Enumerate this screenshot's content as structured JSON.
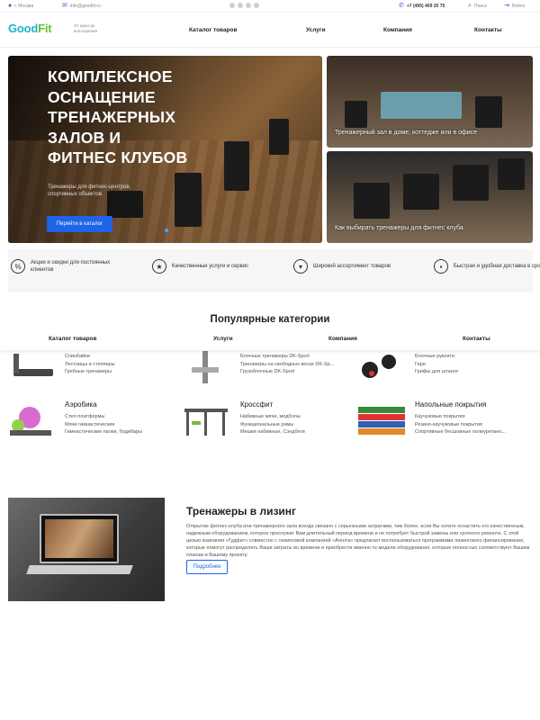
{
  "topbar": {
    "city": "г. Москва",
    "email": "info@goodfit.ru",
    "phone": "+7 (495) 409 20 75",
    "search": "Поиск",
    "login": "Войти"
  },
  "header": {
    "logo_part1": "Good",
    "logo_part2": "Fit",
    "tagline": "От идеи до воплощения",
    "nav": [
      "Каталог товаров",
      "Услуги",
      "Компания",
      "Контакты"
    ]
  },
  "hero": {
    "title": "Комплексное оснащение тренажерных залов и фитнес клубов",
    "subtitle": "Тренажеры для фитнес-центров, спортивных объектов.",
    "button": "Перейти в каталог",
    "side1": "Тренажерный зал в доме, коттедже или в офисе",
    "side2": "Как выбирать тренажеры для фитнес клуба"
  },
  "features": [
    "Акции и скидки для постоянных клиентов",
    "Качественные услуги и сервис",
    "Широкий ассортимент товаров",
    "Быстрая и удобная доставка в срок"
  ],
  "categories_heading": "Популярные категории",
  "sticky_nav": [
    "Каталог товаров",
    "Услуги",
    "Компания",
    "Контакты"
  ],
  "categories": [
    {
      "title": "",
      "items": [
        "Спинбайки",
        "Лестницы и степперы",
        "Гребные тренажеры"
      ]
    },
    {
      "title": "",
      "items": [
        "Блочные тренажеры DK-Sport",
        "Тренажеры на свободных весах DK-Sp...",
        "Грузоблочные DK-Sport"
      ]
    },
    {
      "title": "",
      "items": [
        "Блочные рукояти",
        "Гири",
        "Грифы для штанги"
      ]
    },
    {
      "title": "Аэробика",
      "items": [
        "Степ-платформы",
        "Мячи гимнастические",
        "Гимнастические палки, бодибары"
      ]
    },
    {
      "title": "Кроссфит",
      "items": [
        "Набивные мячи, медболы",
        "Функциональные рамы",
        "Мешки набивные, Сэндбеги"
      ]
    },
    {
      "title": "Напольные покрытия",
      "items": [
        "Каучуковые покрытия",
        "Резино-каучуковые покрытия",
        "Спортивные бесшовные полиуретано..."
      ]
    }
  ],
  "leasing": {
    "title": "Тренажеры в лизинг",
    "text": "Открытие фитнес-клуба или тренажерного зала всегда связано с серьезными затратами, тем более, если Вы хотите оснастить его качественным, надежным оборудованием, которое прослужит Вам длительный период времени и не потребует быстрой замены или срочного ремонта. С этой целью компания «Гудфит» совместно с лизинговой компанией «Агента» предлагает воспользоваться программами лизингового финансирования, которые помогут распределить Ваши затраты во времени и приобрести именно те модели оборудования, которые полностью соответствуют Вашим планам и Вашему проекту.",
    "button": "Подробнее"
  },
  "colors": {
    "accent": "#1f63e6",
    "logo_good": "#1fb4c8",
    "logo_fit": "#6abf2b"
  }
}
